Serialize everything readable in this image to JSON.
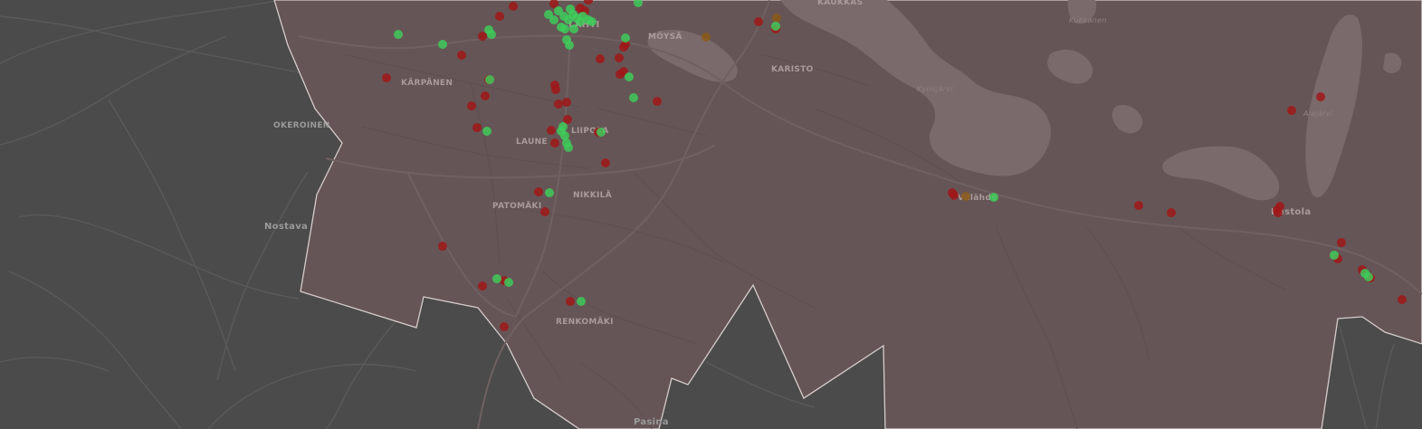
{
  "map": {
    "colors": {
      "background": "#4b4b4b",
      "region_fill": "#665556",
      "region_outline": "#d6cccc",
      "water": "#7a6a6b",
      "road_major": "#6f6162",
      "road_minor": "#5d4f50",
      "road_outside": "#5a5a5a",
      "marker_red": "#a01818",
      "marker_green": "#3ecf5a",
      "marker_orange": "#8c5a1a"
    },
    "labels": [
      {
        "text": "KÄRPÄNEN",
        "kind": "district"
      },
      {
        "text": "MÖYSÄ",
        "kind": "district"
      },
      {
        "text": "KARISTO",
        "kind": "district"
      },
      {
        "text": "OKEROINEN",
        "kind": "outside"
      },
      {
        "text": "LAUNE",
        "kind": "district"
      },
      {
        "text": "LIIPOLA",
        "kind": "district"
      },
      {
        "text": "NIKKILÄ",
        "kind": "district"
      },
      {
        "text": "PATOMÄKI",
        "kind": "district"
      },
      {
        "text": "Nostava",
        "kind": "outside-town"
      },
      {
        "text": "RENKOMÄKI",
        "kind": "district"
      },
      {
        "text": "Pasina",
        "kind": "outside-town"
      },
      {
        "text": "Kastola",
        "kind": "town"
      },
      {
        "text": "KAUKKAS",
        "kind": "district"
      },
      {
        "text": "Villähde",
        "kind": "town"
      },
      {
        "text": "Kymijärvi",
        "kind": "lake"
      },
      {
        "text": "Kukkanen",
        "kind": "lake"
      },
      {
        "text": "Alajärvi",
        "kind": "lake"
      },
      {
        "text": "LAHTI",
        "kind": "district"
      }
    ]
  }
}
